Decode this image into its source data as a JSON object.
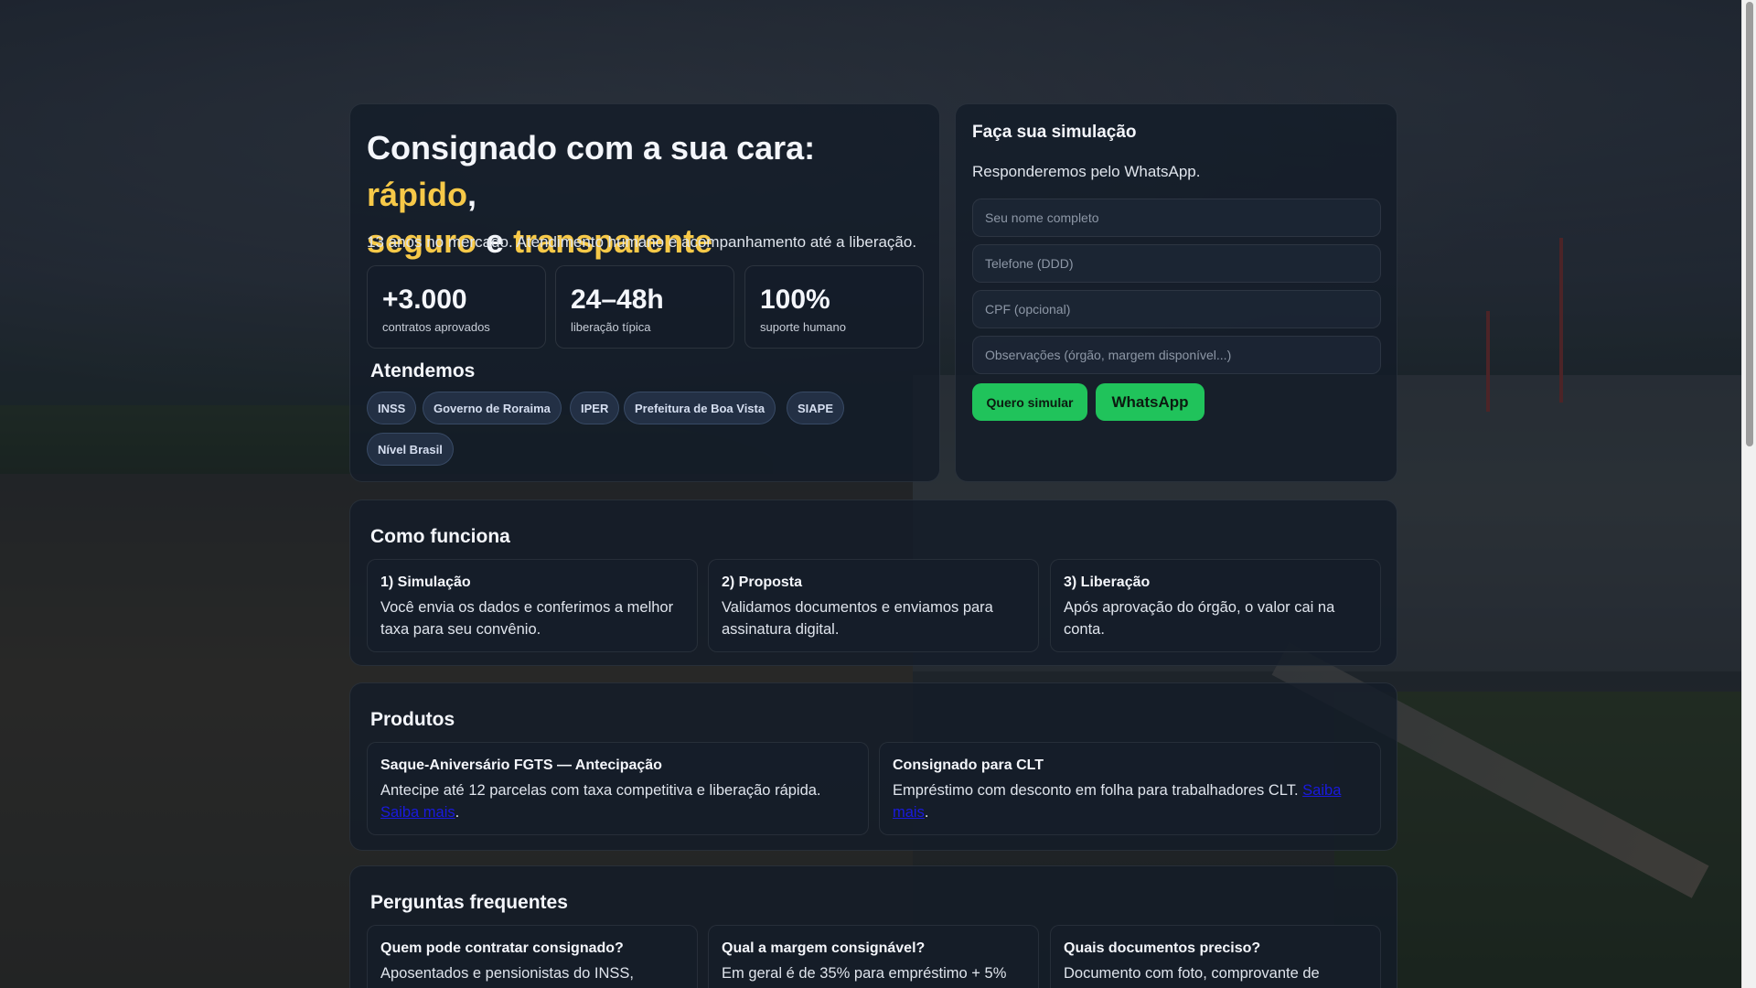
{
  "hero": {
    "title_prefix": "Consignado com a sua cara: ",
    "title_hl1": "rápido",
    "title_sep1": ",",
    "title_hl2": "seguro",
    "title_sep2": " e ",
    "title_hl3": "transparente",
    "lead": "13 anos no mercado. Atendimento humano e acompanhamento até a liberação.",
    "stats": [
      {
        "value": "+3.000",
        "label": "contratos aprovados"
      },
      {
        "value": "24–48h",
        "label": "liberação típica"
      },
      {
        "value": "100%",
        "label": "suporte humano"
      }
    ],
    "serve_title": "Atendemos",
    "chips": [
      "INSS",
      "Governo de Roraima",
      "IPER",
      "Prefeitura de Boa Vista",
      "SIAPE",
      "Nível Brasil"
    ]
  },
  "form": {
    "title": "Faça sua simulação",
    "subtitle": "Responderemos pelo WhatsApp.",
    "name_placeholder": "Seu nome completo",
    "phone_placeholder": "Telefone (DDD)",
    "cpf_placeholder": "CPF (opcional)",
    "notes_placeholder": "Observações (órgão, margem disponível...)",
    "simulate_label": "Quero simular",
    "whatsapp_label": "WhatsApp"
  },
  "how": {
    "title": "Como funciona",
    "steps": [
      {
        "title": "1) Simulação",
        "text": "Você envia os dados e conferimos a melhor taxa para seu convênio."
      },
      {
        "title": "2) Proposta",
        "text": "Validamos documentos e enviamos para assinatura digital."
      },
      {
        "title": "3) Liberação",
        "text": "Após aprovação do órgão, o valor cai na conta."
      }
    ]
  },
  "products": {
    "title": "Produtos",
    "items": [
      {
        "title": "Saque-Aniversário FGTS — Antecipação",
        "text": "Antecipe até 12 parcelas com taxa competitiva e liberação rápida. ",
        "link": "Saiba mais"
      },
      {
        "title": "Consignado para CLT",
        "text": "Empréstimo com desconto em folha para trabalhadores CLT. ",
        "link": "Saiba mais"
      }
    ]
  },
  "faq": {
    "title": "Perguntas frequentes",
    "items": [
      {
        "q": "Quem pode contratar consignado?",
        "a": "Aposentados e pensionistas do INSS,"
      },
      {
        "q": "Qual a margem consignável?",
        "a": "Em geral é de 35% para empréstimo + 5%"
      },
      {
        "q": "Quais documentos preciso?",
        "a": "Documento com foto, comprovante de"
      }
    ]
  },
  "colors": {
    "highlight": "#f7c948",
    "accent_green": "#20c35b",
    "link": "#1a1adf"
  }
}
